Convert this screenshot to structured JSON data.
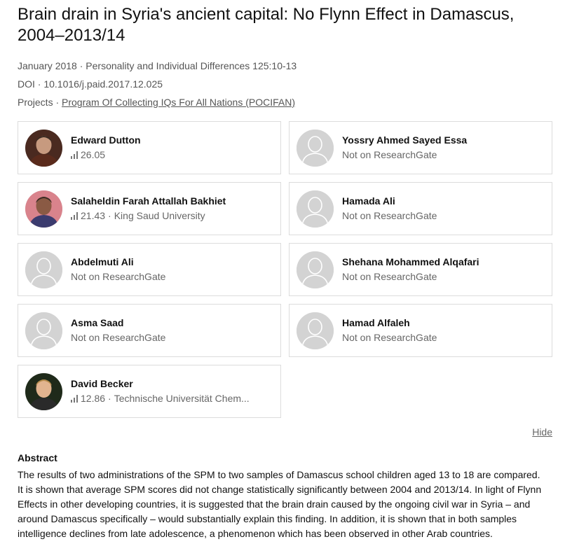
{
  "title": "Brain drain in Syria's ancient capital: No Flynn Effect in Damascus, 2004–2013/14",
  "meta": {
    "date_journal": "January 2018 · Personality and Individual Differences 125:10-13",
    "doi": "DOI · 10.1016/j.paid.2017.12.025",
    "projects_label": "Projects ·",
    "project_link": "Program Of Collecting IQs For All Nations (POCIFAN)"
  },
  "authors": [
    {
      "name": "Edward Dutton",
      "score": "26.05",
      "affiliation": "",
      "status": "",
      "has_photo": true,
      "photo_bg": "#4a2a20",
      "photo_fg": "#c79a7f",
      "photo_shirt": "#5a2b1c"
    },
    {
      "name": "Yossry Ahmed Sayed Essa",
      "score": "",
      "affiliation": "",
      "status": "Not on ResearchGate",
      "has_photo": false
    },
    {
      "name": "Salaheldin Farah Attallah Bakhiet",
      "score": "21.43",
      "affiliation": "King Saud University",
      "status": "",
      "has_photo": true,
      "photo_bg": "#d9838c",
      "photo_fg": "#8a5a44",
      "photo_shirt": "#3b3b6e"
    },
    {
      "name": "Hamada Ali",
      "score": "",
      "affiliation": "",
      "status": "Not on ResearchGate",
      "has_photo": false
    },
    {
      "name": "Abdelmuti Ali",
      "score": "",
      "affiliation": "",
      "status": "Not on ResearchGate",
      "has_photo": false
    },
    {
      "name": "Shehana Mohammed Alqafari",
      "score": "",
      "affiliation": "",
      "status": "Not on ResearchGate",
      "has_photo": false
    },
    {
      "name": "Asma Saad",
      "score": "",
      "affiliation": "",
      "status": "Not on ResearchGate",
      "has_photo": false
    },
    {
      "name": "Hamad Alfaleh",
      "score": "",
      "affiliation": "",
      "status": "Not on ResearchGate",
      "has_photo": false
    },
    {
      "name": "David Becker",
      "score": "12.86",
      "affiliation": "Technische Universität Chem...",
      "status": "",
      "has_photo": true,
      "photo_bg": "#1f2a1a",
      "photo_fg": "#e2b48f",
      "photo_shirt": "#2a2a2a",
      "photo_hair": "#b48a4a"
    }
  ],
  "hide_label": "Hide",
  "abstract": {
    "heading": "Abstract",
    "text": "The results of two administrations of the SPM to two samples of Damascus school children aged 13 to 18 are compared. It is shown that average SPM scores did not change statistically significantly between 2004 and 2013/14. In light of Flynn Effects in other developing countries, it is suggested that the brain drain caused by the ongoing civil war in Syria – and around Damascus specifically – would substantially explain this finding. In addition, it is shown that in both samples intelligence declines from late adolescence, a phenomenon which has been observed in other Arab countries."
  },
  "colors": {
    "placeholder_bg": "#d3d3d3",
    "placeholder_fg": "#ffffff",
    "score_icon": "#777777",
    "card_border": "#dcdcdc"
  }
}
